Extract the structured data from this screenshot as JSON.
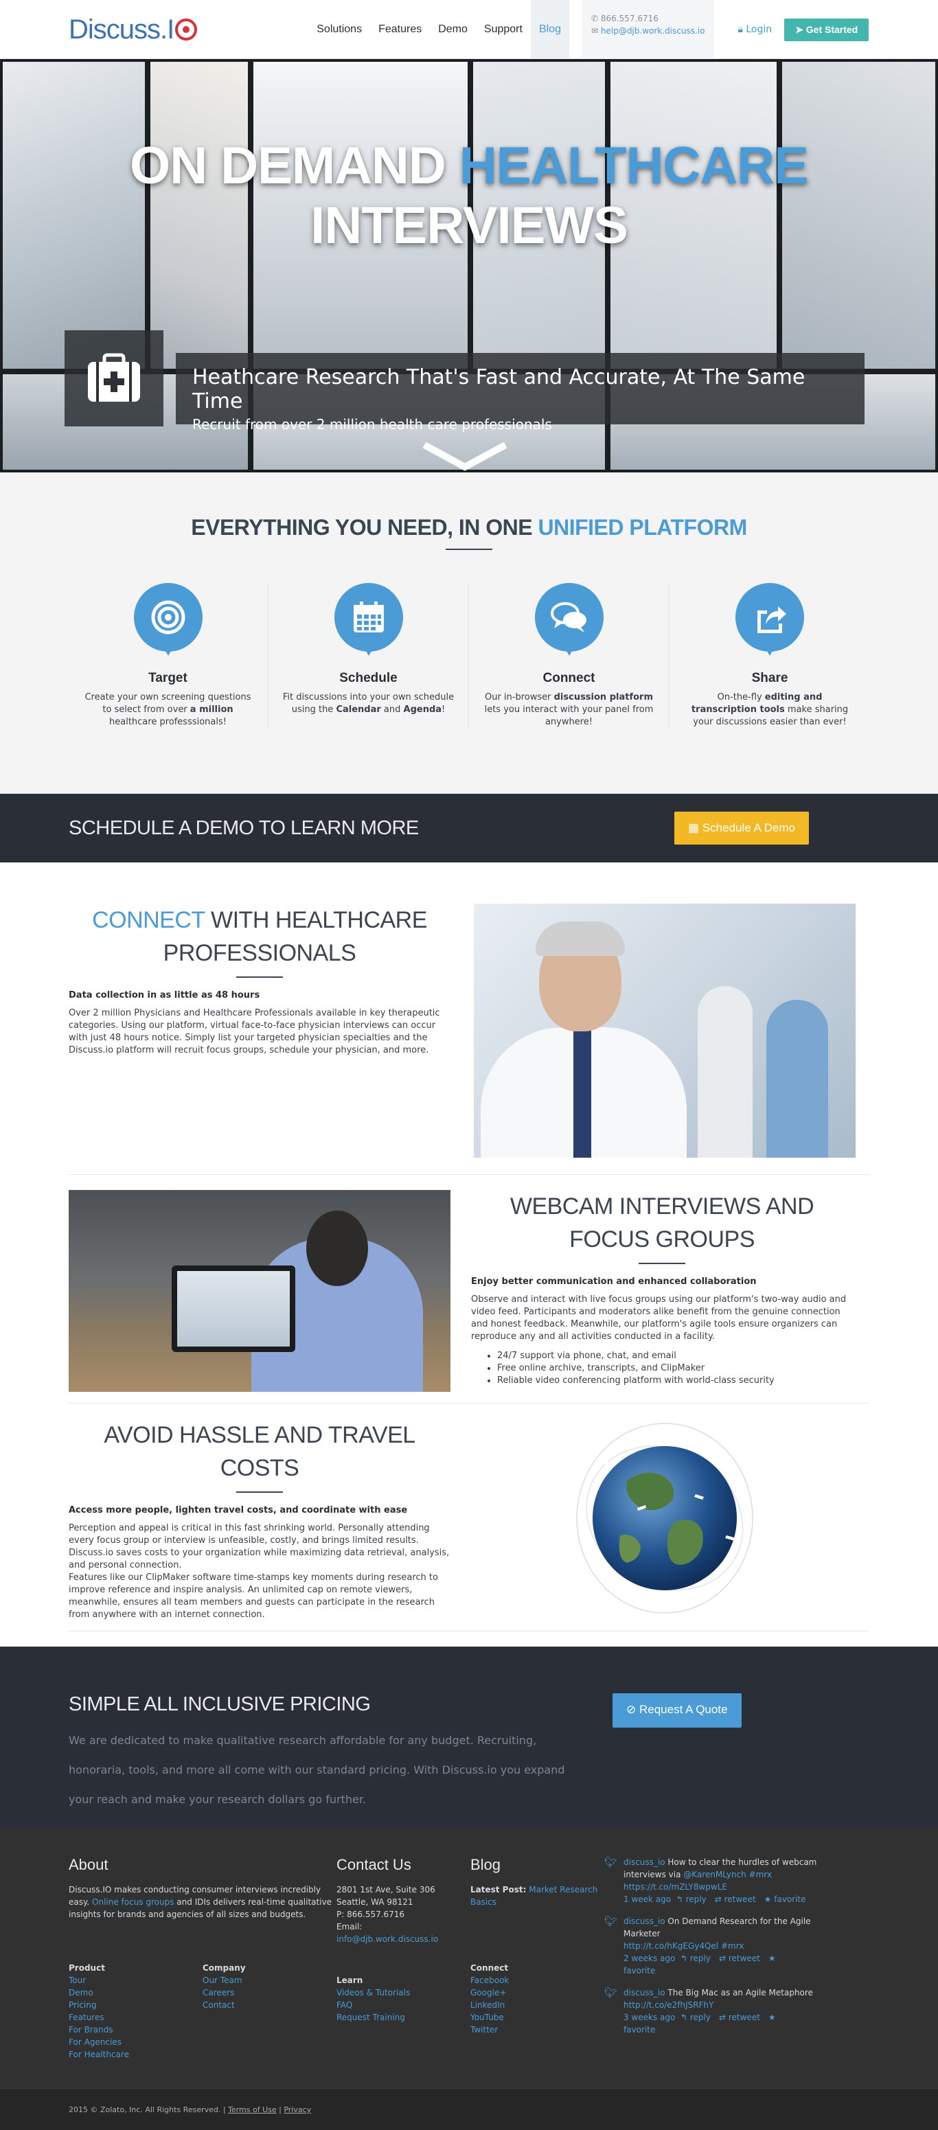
{
  "header": {
    "logo_text": "Discuss.I",
    "nav": [
      "Solutions",
      "Features",
      "Demo",
      "Support",
      "Blog"
    ],
    "phone": "866.557.6716",
    "email": "help@djb.work.discuss.io",
    "login": "Login",
    "cta": "Get Started",
    "accent": "#4a99d6",
    "cta_color": "#45b6ad"
  },
  "hero": {
    "title_a": "ON DEMAND ",
    "title_b": "HEALTHCARE",
    "title_c": " INTERVIEWS",
    "caption_title": "Heathcare Research That's Fast and Accurate, At The Same Time",
    "caption_sub": "Recruit from over 2 million health care professionals",
    "icon": "medical-kit-icon"
  },
  "features": {
    "title_a": "EVERYTHING YOU NEED, IN ONE ",
    "title_b": "UNIFIED PLATFORM",
    "items": [
      {
        "title": "Target",
        "icon": "target-icon",
        "pre": "Create your own screening questions to select from over ",
        "bold": "a million",
        "post": " healthcare professsionals!"
      },
      {
        "title": "Schedule",
        "icon": "calendar-icon",
        "pre": "Fit discussions into your own schedule using the ",
        "bold": "Calendar",
        "mid": " and ",
        "bold2": "Agenda",
        "post": "!"
      },
      {
        "title": "Connect",
        "icon": "chat-bubbles-icon",
        "pre": "Our in-browser ",
        "bold": "discussion platform",
        "post": " lets you interact with your panel from anywhere!"
      },
      {
        "title": "Share",
        "icon": "share-icon",
        "pre": "On-the-fly ",
        "bold": "editing and transcription tools",
        "post": " make sharing your discussions easier than ever!"
      }
    ]
  },
  "demo_bar": {
    "title": "SCHEDULE A DEMO TO LEARN MORE",
    "button": "Schedule A Demo",
    "button_color": "#f2b826"
  },
  "connect": {
    "title_a": "CONNECT",
    "title_b": " WITH HEALTHCARE PROFESSIONALS",
    "subhead": "Data collection in as little as 48 hours",
    "body": "Over 2 million Physicians and Healthcare Professionals available in key therapeutic categories. Using our platform, virtual face-to-face physician interviews can occur with just 48 hours notice. Simply list your targeted physician specialties and the Discuss.io platform will recruit focus groups, schedule your physician, and more."
  },
  "webcam": {
    "title": "WEBCAM INTERVIEWS AND FOCUS GROUPS",
    "subhead": "Enjoy better communication and enhanced collaboration",
    "body": "Observe and interact with live focus groups using our platform's two-way audio and video feed. Participants and moderators alike benefit from the genuine connection and honest feedback. Meanwhile, our platform's agile tools ensure organizers can reproduce any and all activities conducted in a facility.",
    "bullets": [
      "24/7 support via phone, chat, and email",
      "Free online archive, transcripts, and ClipMaker",
      "Reliable video conferencing platform with world-class security"
    ]
  },
  "travel": {
    "title": "AVOID HASSLE AND TRAVEL COSTS",
    "subhead": "Access more people, lighten travel costs, and coordinate with ease",
    "body1": "Perception and appeal is critical in this fast shrinking world. Personally attending every focus group or interview is unfeasible, costly, and brings limited results. Discuss.io saves costs to your organization while maximizing data retrieval, analysis, and personal connection.",
    "body2": "Features like our ClipMaker software time-stamps key moments during research to improve reference and inspire analysis. An unlimited cap on remote viewers, meanwhile, ensures all team members and guests can participate in the research from anywhere with an internet connection."
  },
  "pricing": {
    "title": "SIMPLE ALL INCLUSIVE PRICING",
    "body": "We are dedicated to make qualitative research affordable for any budget. Recruiting, honoraria, tools, and more all come with our standard pricing. With Discuss.io you expand your reach and make your research dollars go further.",
    "button": "Request A Quote"
  },
  "footer": {
    "about_title": "About",
    "about_pre": "Discuss.IO makes conducting consumer interviews incredibly easy. ",
    "about_link": "Online focus groups",
    "about_post": " and IDIs delivers real-time qualitative insights for brands and agencies of all sizes and budgets.",
    "contact_title": "Contact Us",
    "address1": "2801 1st Ave, Suite 306",
    "address2": "Seattle, WA 98121",
    "phone": "P: 866.557.6716",
    "email_label": "Email:",
    "email": "info@djb.work.discuss.io",
    "blog_title": "Blog",
    "latest_label": "Latest Post:",
    "latest_post": "Market Research Basics",
    "links": [
      {
        "heading": "Product",
        "items": [
          "Tour",
          "Demo",
          "Pricing",
          "Features",
          "For Brands",
          "For Agencies",
          "For Healthcare"
        ]
      },
      {
        "heading": "Company",
        "items": [
          "Our Team",
          "Careers",
          "Contact"
        ]
      },
      {
        "heading": "Learn",
        "items": [
          "Videos & Tutorials",
          "FAQ",
          "Request Training"
        ]
      },
      {
        "heading": "Connect",
        "items": [
          "Facebook",
          "Google+",
          "LinkedIn",
          "YouTube",
          "Twitter"
        ]
      }
    ],
    "tweets": [
      {
        "handle": "discuss_io",
        "text": " How to clear the hurdles of webcam interviews via ",
        "mention": "@KarenMLynch",
        "tag": " #mrx",
        "url": "https://t.co/mZLY8wpwLE",
        "age": "1 week ago"
      },
      {
        "handle": "discuss_io",
        "text": " On Demand Research for the Agile Marketer ",
        "mention": "",
        "tag": "",
        "url": "http://t.co/hKgEGy4Qel #mrx",
        "age": "2 weeks ago"
      },
      {
        "handle": "discuss_io",
        "text": " The Big Mac as an Agile Metaphore ",
        "mention": "",
        "tag": "",
        "url": "http://t.co/e2fhJSRFhY",
        "age": "3 weeks ago"
      }
    ],
    "tweet_actions": [
      "reply",
      "retweet",
      "favorite"
    ],
    "copyright": "2015 © Zolato, Inc. All Rights Reserved. | ",
    "terms": "Terms of Use",
    "sep": " | ",
    "privacy": "Privacy"
  }
}
